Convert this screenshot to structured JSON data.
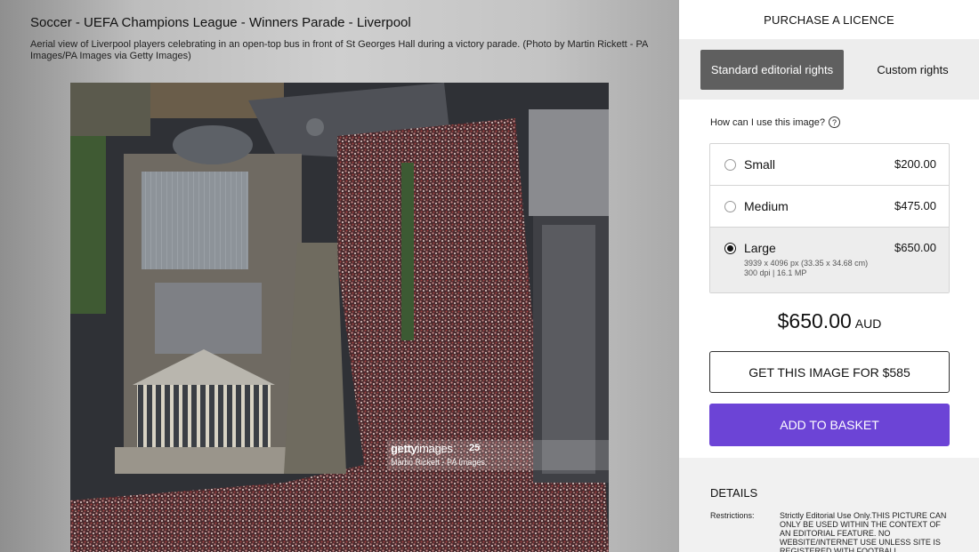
{
  "viewer": {
    "title": "Soccer - UEFA Champions League - Winners Parade - Liverpool",
    "caption": "Aerial view of Liverpool players celebrating in an open-top bus in front of St Georges Hall during a victory parade. (Photo by Martin Rickett - PA Images/PA Images via Getty Images)",
    "watermark": {
      "brand_bold": "getty",
      "brand_light": "images",
      "years_mark": "25",
      "credit": "Martin Rickett - PA Images"
    }
  },
  "panel": {
    "heading": "PURCHASE A LICENCE",
    "rights": {
      "standard_label": "Standard editorial rights",
      "custom_label": "Custom rights",
      "selected": "standard"
    },
    "how_label": "How can I use this image?",
    "help_glyph": "?",
    "options": [
      {
        "name": "Small",
        "price": "$200.00",
        "selected": false
      },
      {
        "name": "Medium",
        "price": "$475.00",
        "selected": false
      },
      {
        "name": "Large",
        "price": "$650.00",
        "selected": true,
        "detail_line1": "3939 x 4096 px (33.35 x 34.68 cm)",
        "detail_line2": "300 dpi | 16.1 MP"
      }
    ],
    "total_amount": "$650.00",
    "total_currency": "AUD",
    "get_image_label": "GET THIS IMAGE FOR $585",
    "add_basket_label": "ADD TO BASKET",
    "accent_color": "#6c44d6",
    "details": {
      "title": "DETAILS",
      "restrictions_label": "Restrictions:",
      "restrictions_text": "Strictly Editorial Use Only.THIS PICTURE CAN ONLY BE USED WITHIN THE CONTEXT OF AN EDITORIAL FEATURE. NO WEBSITE/INTERNET USE UNLESS SITE IS REGISTERED WITH FOOTBALL"
    }
  }
}
